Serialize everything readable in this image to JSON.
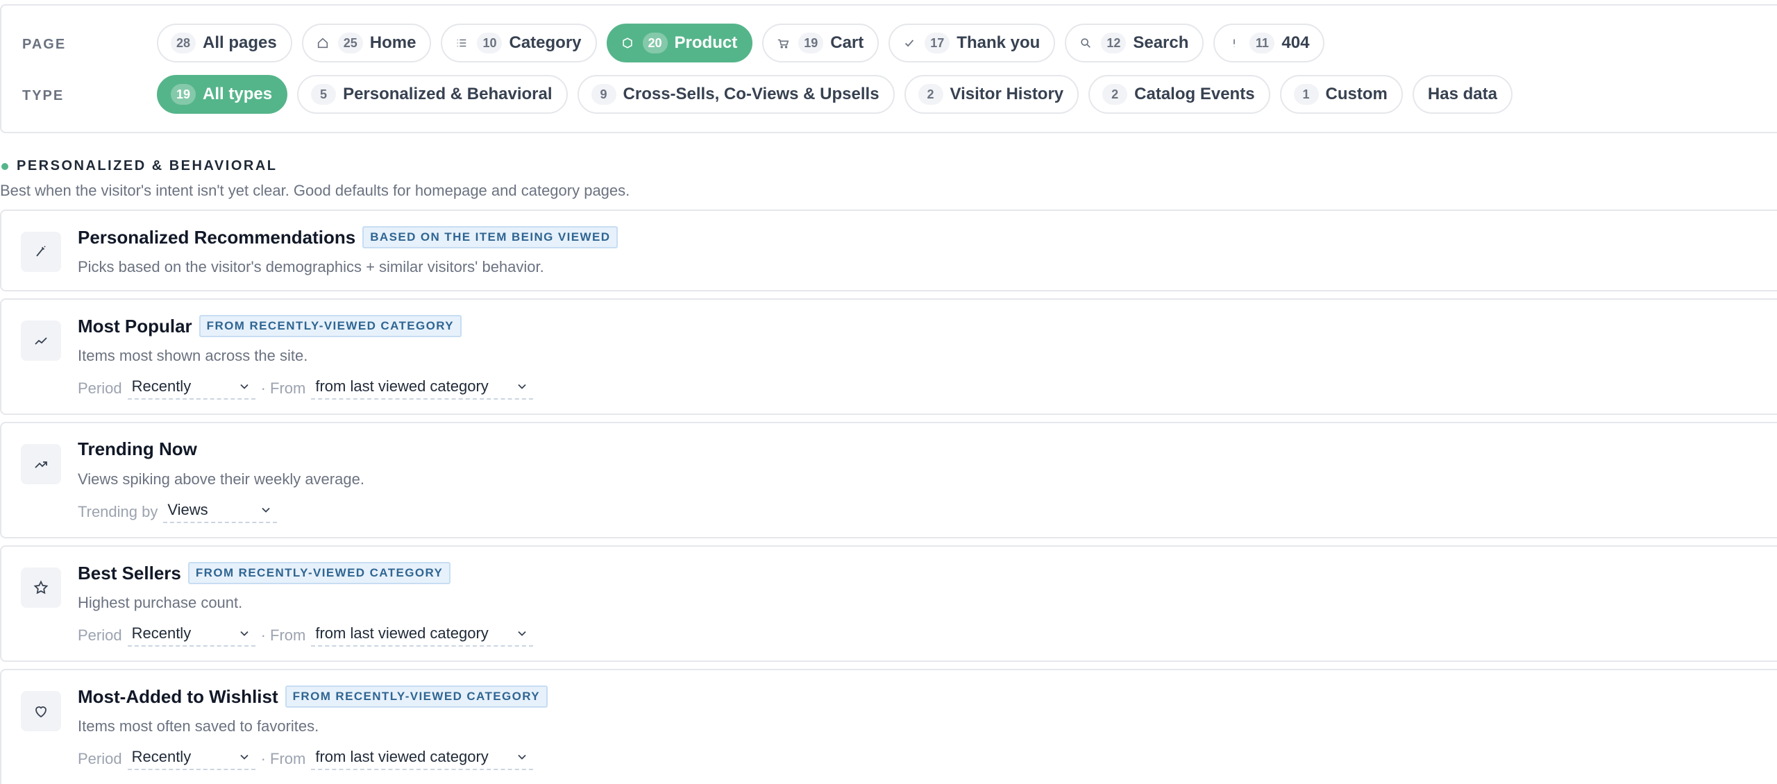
{
  "filters": {
    "page_label": "PAGE",
    "type_label": "TYPE",
    "pages": [
      {
        "icon": "none",
        "count": "28",
        "label": "All pages",
        "active": false
      },
      {
        "icon": "home-icon",
        "count": "25",
        "label": "Home",
        "active": false
      },
      {
        "icon": "list-icon",
        "count": "10",
        "label": "Category",
        "active": false
      },
      {
        "icon": "product-icon",
        "count": "20",
        "label": "Product",
        "active": true
      },
      {
        "icon": "cart-icon",
        "count": "19",
        "label": "Cart",
        "active": false
      },
      {
        "icon": "check-icon",
        "count": "17",
        "label": "Thank you",
        "active": false
      },
      {
        "icon": "search-icon",
        "count": "12",
        "label": "Search",
        "active": false
      },
      {
        "icon": "alert-icon",
        "count": "11",
        "label": "404",
        "active": false
      }
    ],
    "types": [
      {
        "count": "19",
        "label": "All types",
        "active": true
      },
      {
        "count": "5",
        "label": "Personalized & Behavioral",
        "active": false
      },
      {
        "count": "9",
        "label": "Cross-Sells, Co-Views & Upsells",
        "active": false
      },
      {
        "count": "2",
        "label": "Visitor History",
        "active": false
      },
      {
        "count": "2",
        "label": "Catalog Events",
        "active": false
      },
      {
        "count": "1",
        "label": "Custom",
        "active": false
      },
      {
        "count": "",
        "label": "Has data",
        "active": false
      }
    ]
  },
  "section": {
    "title": "PERSONALIZED & BEHAVIORAL",
    "description": "Best when the visitor's intent isn't yet clear. Good defaults for homepage and category pages."
  },
  "cards": [
    {
      "icon": "wand-icon",
      "title": "Personalized Recommendations",
      "badge": "BASED ON THE ITEM BEING VIEWED",
      "description": "Picks based on the visitor's demographics + similar visitors' behavior."
    },
    {
      "icon": "line-chart-icon",
      "title": "Most Popular",
      "badge": "FROM RECENTLY-VIEWED CATEGORY",
      "description": "Items most shown across the site.",
      "period_label": "Period",
      "period_value": "Recently",
      "from_label": "· From",
      "from_value": "from last viewed category"
    },
    {
      "icon": "trending-up-icon",
      "title": "Trending Now",
      "badge": "",
      "description": "Views spiking above their weekly average.",
      "trend_label": "Trending by",
      "trend_value": "Views"
    },
    {
      "icon": "star-icon",
      "title": "Best Sellers",
      "badge": "FROM RECENTLY-VIEWED CATEGORY",
      "description": "Highest purchase count.",
      "period_label": "Period",
      "period_value": "Recently",
      "from_label": "· From",
      "from_value": "from last viewed category"
    },
    {
      "icon": "heart-icon",
      "title": "Most-Added to Wishlist",
      "badge": "FROM RECENTLY-VIEWED CATEGORY",
      "description": "Items most often saved to favorites.",
      "period_label": "Period",
      "period_value": "Recently",
      "from_label": "· From",
      "from_value": "from last viewed category"
    }
  ],
  "colors": {
    "accent": "#55b58a",
    "badge_bg": "#e7f1fb",
    "badge_text": "#2f6592"
  }
}
